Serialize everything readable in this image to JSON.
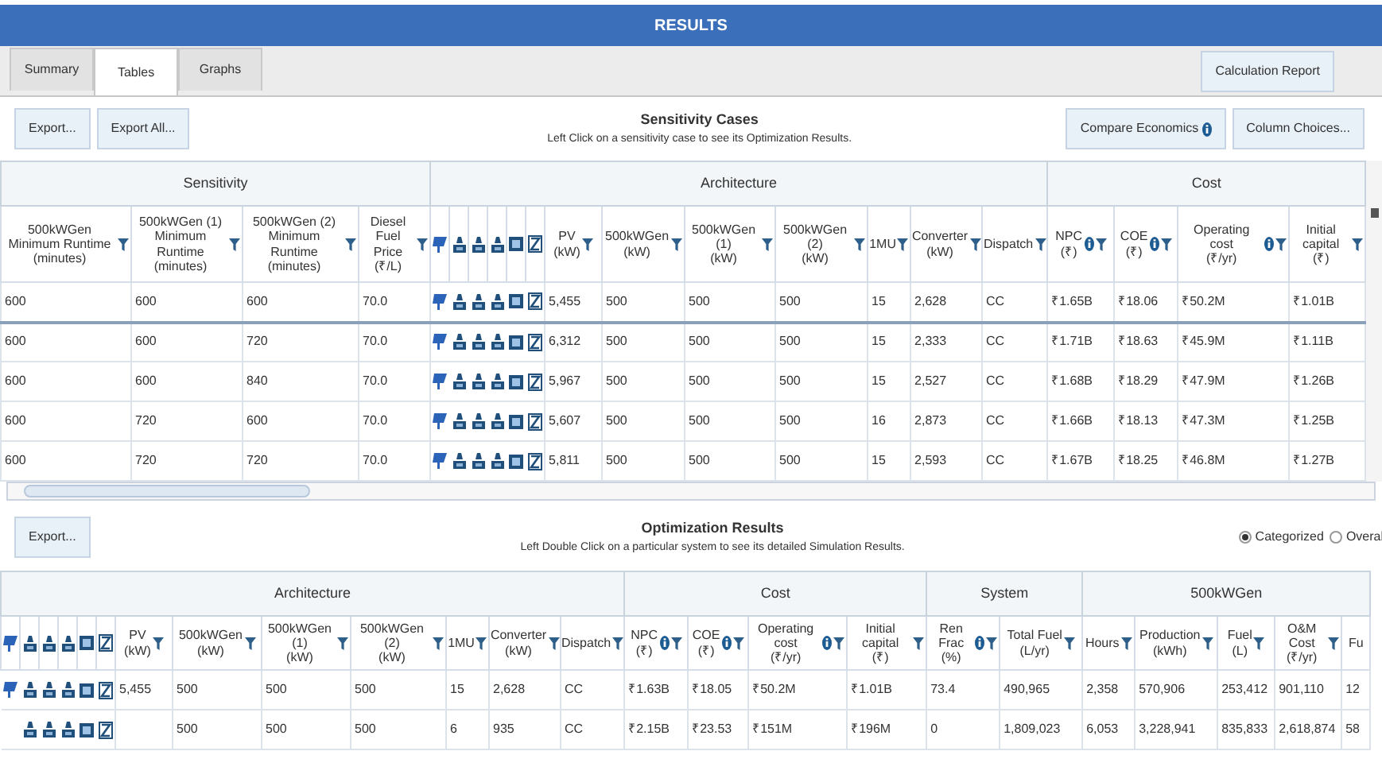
{
  "window": {
    "title": "RESULTS"
  },
  "tabs": [
    {
      "label": "Summary",
      "selected": false
    },
    {
      "label": "Tables",
      "selected": true
    },
    {
      "label": "Graphs",
      "selected": false
    }
  ],
  "calculation_report_button": "Calculation Report",
  "sensitivity": {
    "buttons": [
      "Export...",
      "Export All..."
    ],
    "title": "Sensitivity Cases",
    "subtitle": "Left Click on a sensitivity case to see its Optimization Results.",
    "compare_button": "Compare Economics",
    "column_choices_button": "Column Choices...",
    "groups": [
      {
        "label": "Sensitivity"
      },
      {
        "label": "Architecture"
      },
      {
        "label": "Cost"
      }
    ],
    "columns": [
      {
        "kind": "text",
        "label": "500kWGen Minimum Runtime",
        "unit": "(minutes)",
        "filter": true,
        "info": false
      },
      {
        "kind": "text",
        "label": "500kWGen (1) Minimum Runtime",
        "unit": "(minutes)",
        "filter": true,
        "info": false
      },
      {
        "kind": "text",
        "label": "500kWGen (2) Minimum Runtime",
        "unit": "(minutes)",
        "filter": true,
        "info": false
      },
      {
        "kind": "text",
        "label": "Diesel Fuel Price",
        "unit": "(₹/L)",
        "filter": true,
        "info": false
      },
      {
        "kind": "pv"
      },
      {
        "kind": "gen"
      },
      {
        "kind": "gen"
      },
      {
        "kind": "gen"
      },
      {
        "kind": "storage"
      },
      {
        "kind": "converter"
      },
      {
        "kind": "text",
        "label": "PV",
        "unit": "(kW)",
        "filter": true,
        "info": false
      },
      {
        "kind": "text",
        "label": "500kWGen",
        "unit": "(kW)",
        "filter": true,
        "info": false
      },
      {
        "kind": "text",
        "label": "500kWGen (1)",
        "unit": "(kW)",
        "filter": true,
        "info": false
      },
      {
        "kind": "text",
        "label": "500kWGen (2)",
        "unit": "(kW)",
        "filter": true,
        "info": false
      },
      {
        "kind": "text",
        "label": "1MU",
        "filter": true,
        "info": false
      },
      {
        "kind": "text",
        "label": "Converter",
        "unit": "(kW)",
        "filter": true,
        "info": false
      },
      {
        "kind": "text",
        "label": "Dispatch",
        "filter": true,
        "info": false
      },
      {
        "kind": "text",
        "label": "NPC",
        "unit": "(₹)",
        "filter": true,
        "info": true
      },
      {
        "kind": "text",
        "label": "COE",
        "unit": "(₹)",
        "filter": true,
        "info": true
      },
      {
        "kind": "text",
        "label": "Operating cost",
        "unit": "(₹/yr)",
        "filter": true,
        "info": true
      },
      {
        "kind": "text",
        "label": "Initial capital",
        "unit": "(₹)",
        "filter": true,
        "info": false
      }
    ],
    "rows": [
      {
        "selected": true,
        "cells": [
          "600",
          "600",
          "600",
          "70.0",
          true,
          true,
          true,
          true,
          true,
          true,
          "5,455",
          "500",
          "500",
          "500",
          "15",
          "2,628",
          "CC",
          "₹1.65B",
          "₹18.06",
          "₹50.2M",
          "₹1.01B"
        ]
      },
      {
        "selected": false,
        "cells": [
          "600",
          "600",
          "720",
          "70.0",
          true,
          true,
          true,
          true,
          true,
          true,
          "6,312",
          "500",
          "500",
          "500",
          "15",
          "2,333",
          "CC",
          "₹1.71B",
          "₹18.63",
          "₹45.9M",
          "₹1.11B"
        ]
      },
      {
        "selected": false,
        "cells": [
          "600",
          "600",
          "840",
          "70.0",
          true,
          true,
          true,
          true,
          true,
          true,
          "5,967",
          "500",
          "500",
          "500",
          "15",
          "2,527",
          "CC",
          "₹1.68B",
          "₹18.29",
          "₹47.9M",
          "₹1.26B"
        ]
      },
      {
        "selected": false,
        "cells": [
          "600",
          "720",
          "600",
          "70.0",
          true,
          true,
          true,
          true,
          true,
          true,
          "5,607",
          "500",
          "500",
          "500",
          "16",
          "2,873",
          "CC",
          "₹1.66B",
          "₹18.13",
          "₹47.3M",
          "₹1.25B"
        ]
      },
      {
        "selected": false,
        "cells": [
          "600",
          "720",
          "720",
          "70.0",
          true,
          true,
          true,
          true,
          true,
          true,
          "5,811",
          "500",
          "500",
          "500",
          "15",
          "2,593",
          "CC",
          "₹1.67B",
          "₹18.25",
          "₹46.8M",
          "₹1.27B"
        ]
      }
    ]
  },
  "optimization": {
    "buttons": [
      "Export..."
    ],
    "title": "Optimization Results",
    "subtitle": "Left Double Click on a particular system to see its detailed Simulation Results.",
    "view_options": [
      {
        "label": "Categorized",
        "selected": true
      },
      {
        "label": "Overal",
        "selected": false
      }
    ],
    "groups": [
      {
        "label": "Architecture"
      },
      {
        "label": "Cost"
      },
      {
        "label": "System"
      },
      {
        "label": "500kWGen"
      }
    ],
    "columns": [
      {
        "kind": "pv"
      },
      {
        "kind": "gen"
      },
      {
        "kind": "gen"
      },
      {
        "kind": "gen"
      },
      {
        "kind": "storage"
      },
      {
        "kind": "converter"
      },
      {
        "kind": "text",
        "label": "PV",
        "unit": "(kW)",
        "filter": true,
        "info": false
      },
      {
        "kind": "text",
        "label": "500kWGen",
        "unit": "(kW)",
        "filter": true,
        "info": false
      },
      {
        "kind": "text",
        "label": "500kWGen (1)",
        "unit": "(kW)",
        "filter": true,
        "info": false
      },
      {
        "kind": "text",
        "label": "500kWGen (2)",
        "unit": "(kW)",
        "filter": true,
        "info": false
      },
      {
        "kind": "text",
        "label": "1MU",
        "filter": true,
        "info": false
      },
      {
        "kind": "text",
        "label": "Converter",
        "unit": "(kW)",
        "filter": true,
        "info": false
      },
      {
        "kind": "text",
        "label": "Dispatch",
        "filter": true,
        "info": false
      },
      {
        "kind": "text",
        "label": "NPC",
        "unit": "(₹)",
        "filter": true,
        "info": true
      },
      {
        "kind": "text",
        "label": "COE",
        "unit": "(₹)",
        "filter": true,
        "info": true
      },
      {
        "kind": "text",
        "label": "Operating cost",
        "unit": "(₹/yr)",
        "filter": true,
        "info": true
      },
      {
        "kind": "text",
        "label": "Initial capital",
        "unit": "(₹)",
        "filter": true,
        "info": false
      },
      {
        "kind": "text",
        "label": "Ren Frac",
        "unit": "(%)",
        "filter": true,
        "info": true
      },
      {
        "kind": "text",
        "label": "Total Fuel",
        "unit": "(L/yr)",
        "filter": true,
        "info": false
      },
      {
        "kind": "text",
        "label": "Hours",
        "filter": true,
        "info": false
      },
      {
        "kind": "text",
        "label": "Production",
        "unit": "(kWh)",
        "filter": true,
        "info": false
      },
      {
        "kind": "text",
        "label": "Fuel",
        "unit": "(L)",
        "filter": true,
        "info": false
      },
      {
        "kind": "text",
        "label": "O&M Cost",
        "unit": "(₹/yr)",
        "filter": true,
        "info": false
      },
      {
        "kind": "text",
        "label": "Fu",
        "filter": false,
        "info": false
      }
    ],
    "rows": [
      {
        "selected": false,
        "cells": [
          true,
          true,
          true,
          true,
          true,
          true,
          "5,455",
          "500",
          "500",
          "500",
          "15",
          "2,628",
          "CC",
          "₹1.63B",
          "₹18.05",
          "₹50.2M",
          "₹1.01B",
          "73.4",
          "490,965",
          "2,358",
          "570,906",
          "253,412",
          "901,110",
          "12"
        ]
      },
      {
        "selected": false,
        "cells": [
          false,
          true,
          true,
          true,
          true,
          true,
          "",
          "500",
          "500",
          "500",
          "6",
          "935",
          "CC",
          "₹2.15B",
          "₹23.53",
          "₹151M",
          "₹196M",
          "0",
          "1,809,023",
          "6,053",
          "3,228,941",
          "835,833",
          "2,618,874",
          "58"
        ]
      }
    ]
  }
}
